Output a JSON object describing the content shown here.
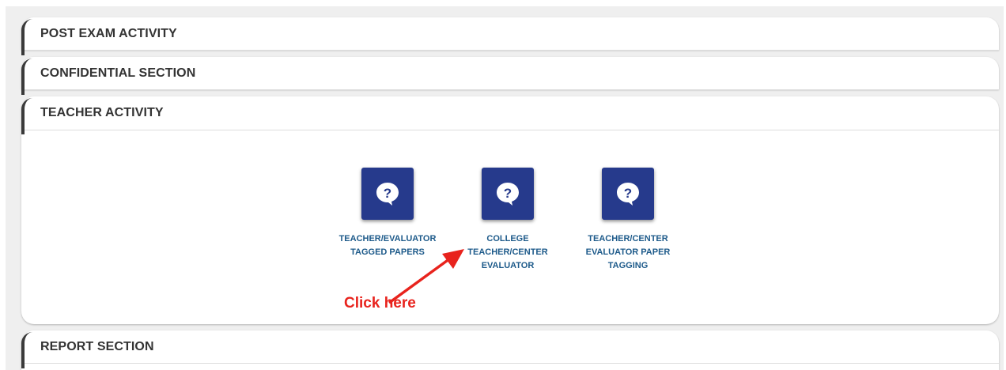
{
  "panels": [
    {
      "title": "POST EXAM ACTIVITY"
    },
    {
      "title": "CONFIDENTIAL SECTION"
    },
    {
      "title": "TEACHER ACTIVITY",
      "tiles": [
        {
          "label": "TEACHER/EVALUATOR\nTAGGED PAPERS",
          "icon": "help-bubble-icon"
        },
        {
          "label": "COLLEGE\nTEACHER/CENTER\nEVALUATOR",
          "icon": "help-bubble-icon"
        },
        {
          "label": "TEACHER/CENTER\nEVALUATOR PAPER\nTAGGING",
          "icon": "help-bubble-icon"
        }
      ]
    },
    {
      "title": "REPORT SECTION"
    }
  ],
  "annotation": {
    "text": "Click here",
    "color": "#e8231d"
  },
  "colors": {
    "tile_bg": "#263a8c",
    "tile_label": "#1d5a8a",
    "header_curve": "#3a3a3a"
  }
}
